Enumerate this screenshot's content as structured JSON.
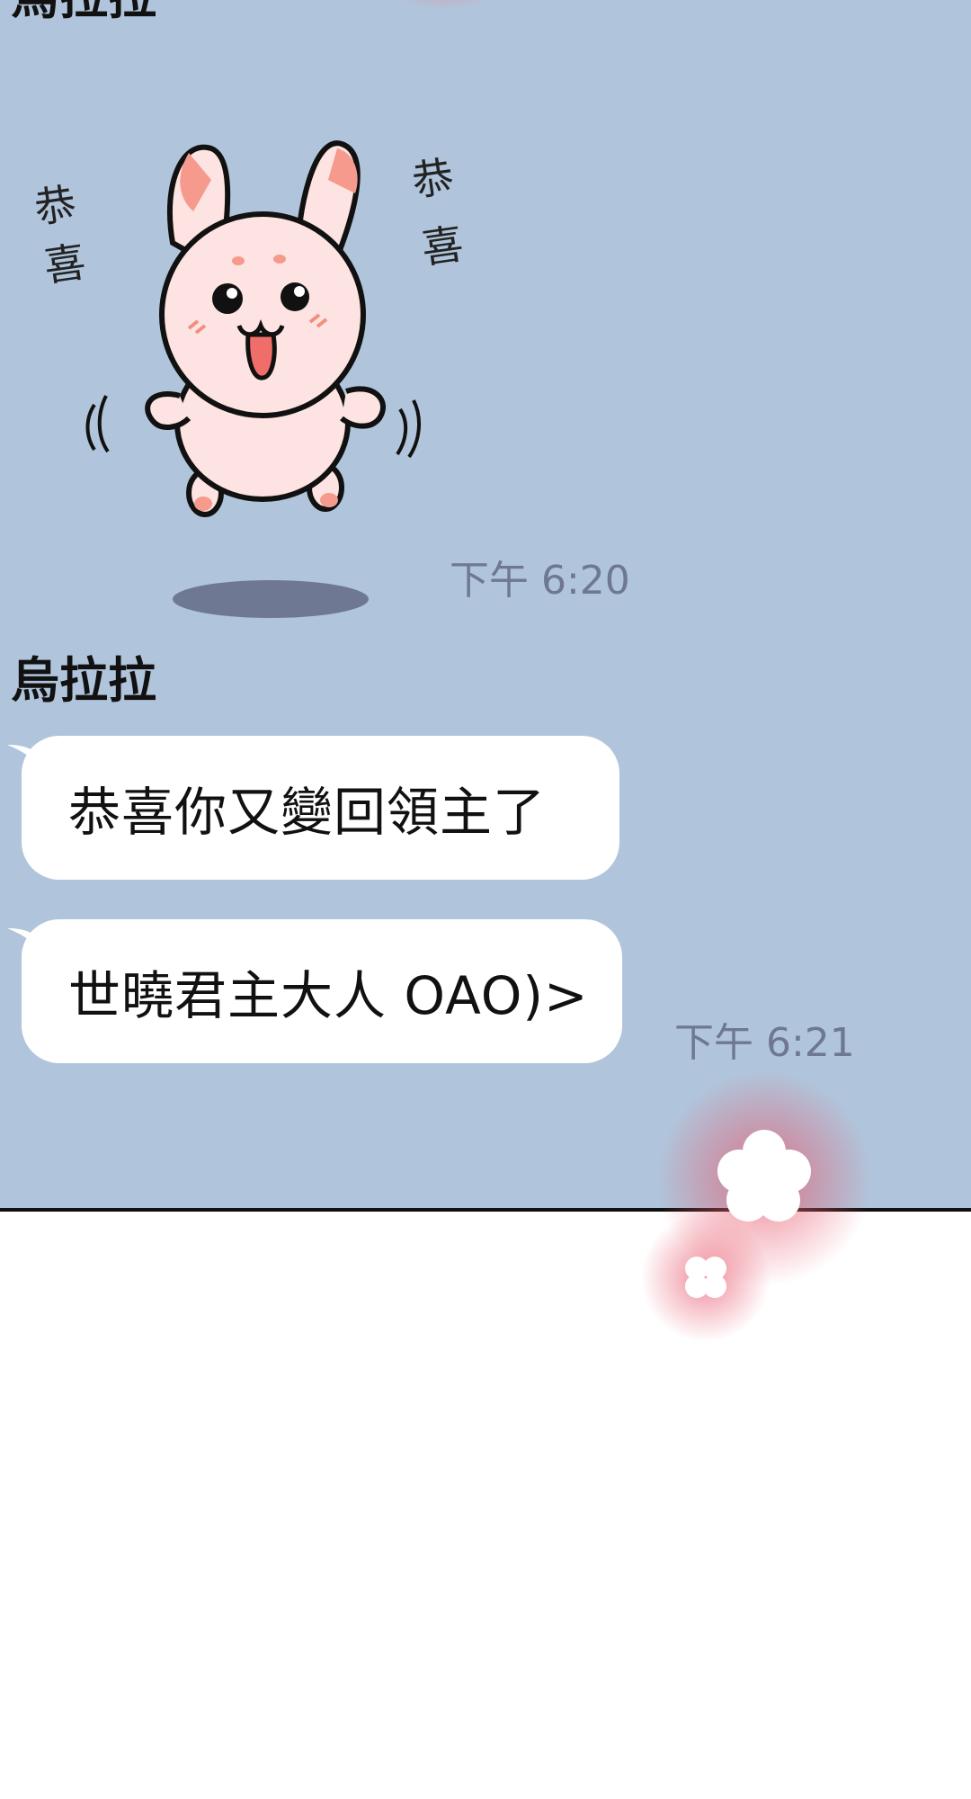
{
  "chat": {
    "partial_top_sender": "烏拉拉",
    "sticker": {
      "name": "rabbit-congrats-sticker",
      "left_text": "恭喜",
      "right_text": "恭喜"
    },
    "sticker_time": "下午 6:20",
    "sender": "烏拉拉",
    "messages": [
      {
        "text": "恭喜你又變回領主了"
      },
      {
        "text": "世曉君主大人 OAO)>"
      }
    ],
    "messages_time": "下午 6:21"
  },
  "colors": {
    "chat_background": "#b0c5db",
    "bubble": "#ffffff",
    "timestamp": "#6e7890",
    "sparkle_glow": "#e85a6e"
  },
  "icons": [
    "sparkle-large-icon",
    "sparkle-small-icon"
  ]
}
